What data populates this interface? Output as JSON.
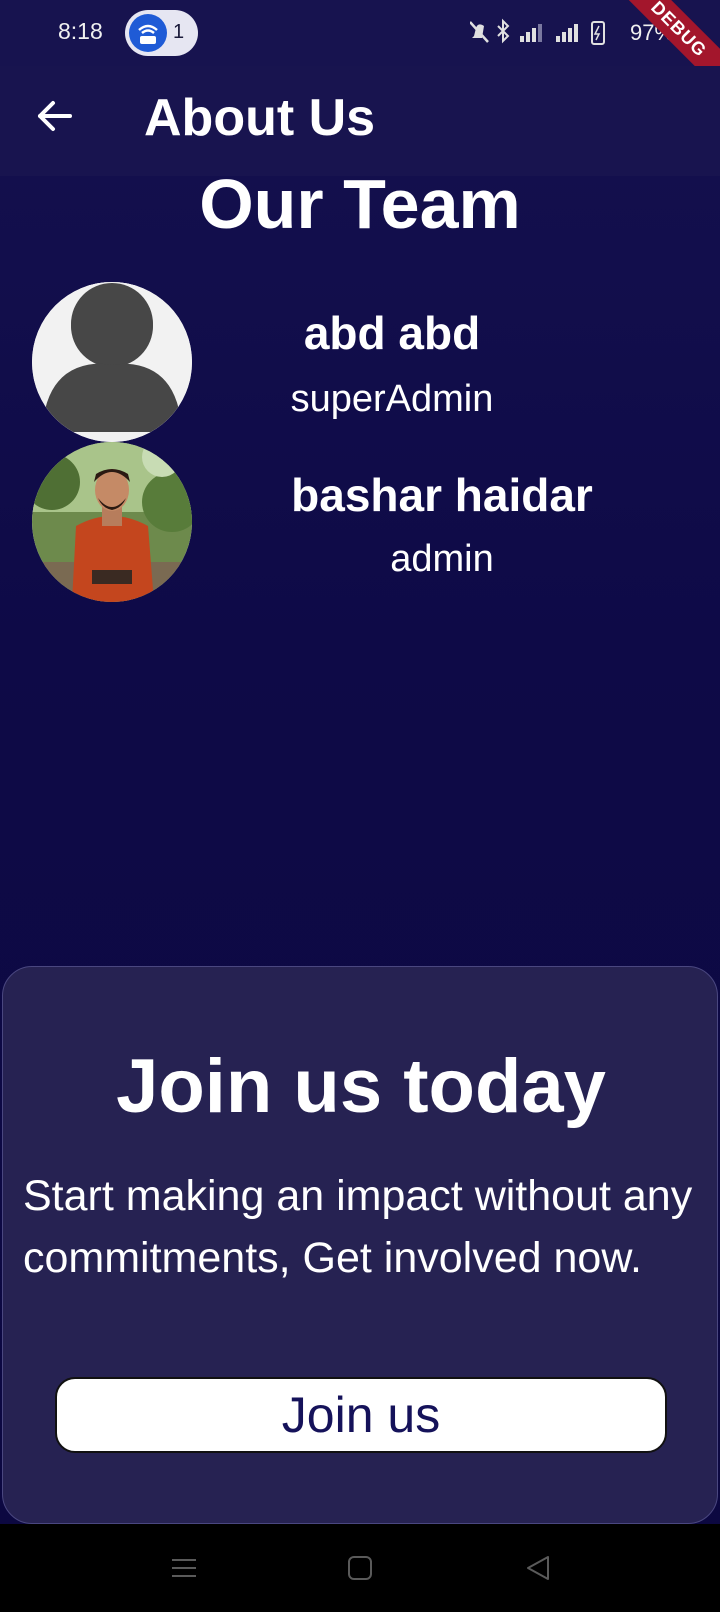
{
  "status_bar": {
    "time": "8:18",
    "hotspot_count": "1",
    "battery": "97%",
    "debug_label": "DEBUG",
    "icons": [
      "wifi-hotspot-icon",
      "mute-icon",
      "bluetooth-icon",
      "signal-icon",
      "battery-icon"
    ]
  },
  "app_bar": {
    "title": "About Us",
    "back_icon": "arrow-left-icon"
  },
  "team": {
    "heading": "Our Team",
    "members": [
      {
        "name": "abd abd",
        "role": "superAdmin",
        "avatar": "default-person-avatar"
      },
      {
        "name": "bashar haidar",
        "role": "admin",
        "avatar": "person-photo-avatar"
      }
    ]
  },
  "join": {
    "title": "Join us today",
    "description": "Start making an impact without any commitments, Get involved now.",
    "button_label": "Join us"
  },
  "nav_bar": {
    "icons": [
      "menu-icon",
      "home-icon",
      "back-icon"
    ]
  },
  "colors": {
    "background": "#0e0b45",
    "card": "#262252",
    "button_text": "#15125a",
    "debug_ribbon": "#a3162c"
  }
}
